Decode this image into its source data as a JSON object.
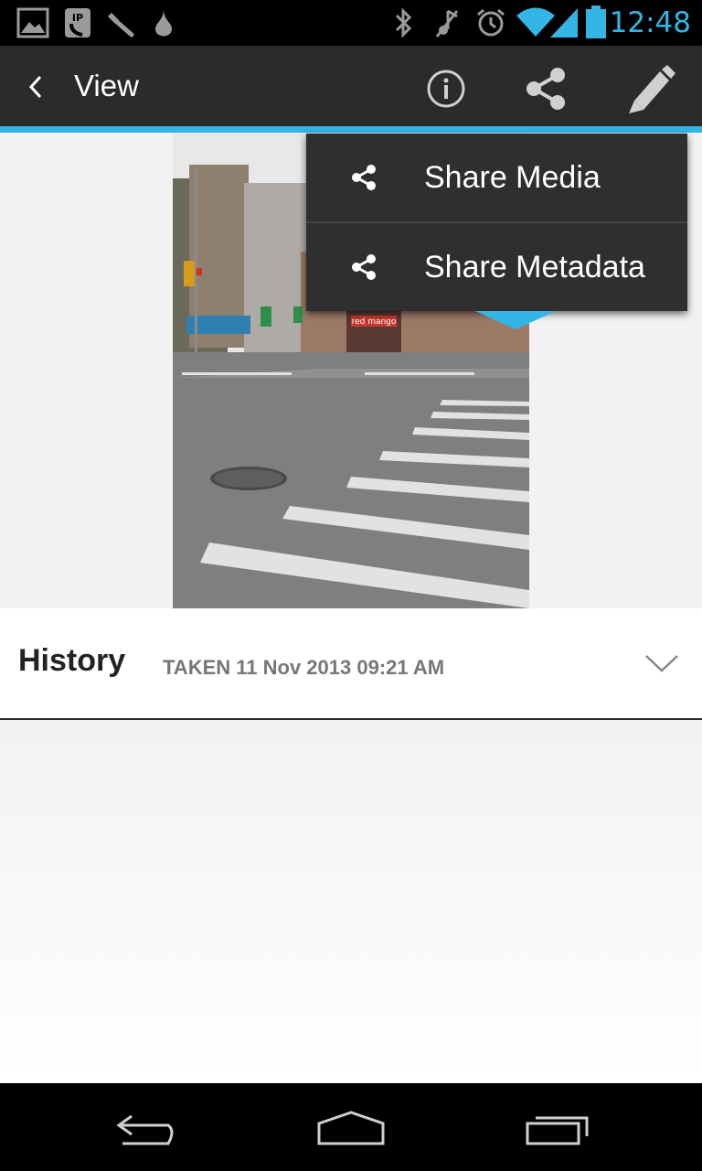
{
  "status_bar": {
    "time": "12:48",
    "icons": [
      "gallery-icon",
      "sip-call-icon",
      "tools-icon",
      "drop-icon",
      "bluetooth-icon",
      "mute-icon",
      "alarm-icon",
      "wifi-icon",
      "signal-icon",
      "battery-icon"
    ]
  },
  "action_bar": {
    "title": "View",
    "actions": [
      "info-icon",
      "share-icon",
      "edit-icon"
    ]
  },
  "share_menu": {
    "items": [
      {
        "label": "Share Media",
        "icon": "share-icon"
      },
      {
        "label": "Share Metadata",
        "icon": "share-icon"
      }
    ]
  },
  "history": {
    "title": "History",
    "meta": "TAKEN 11 Nov 2013 09:21 AM"
  },
  "photo": {
    "sign_text": "red mango"
  },
  "colors": {
    "accent": "#33b5e5",
    "action_bar": "#2b2b2b",
    "menu_bg": "#2f2f2f"
  }
}
